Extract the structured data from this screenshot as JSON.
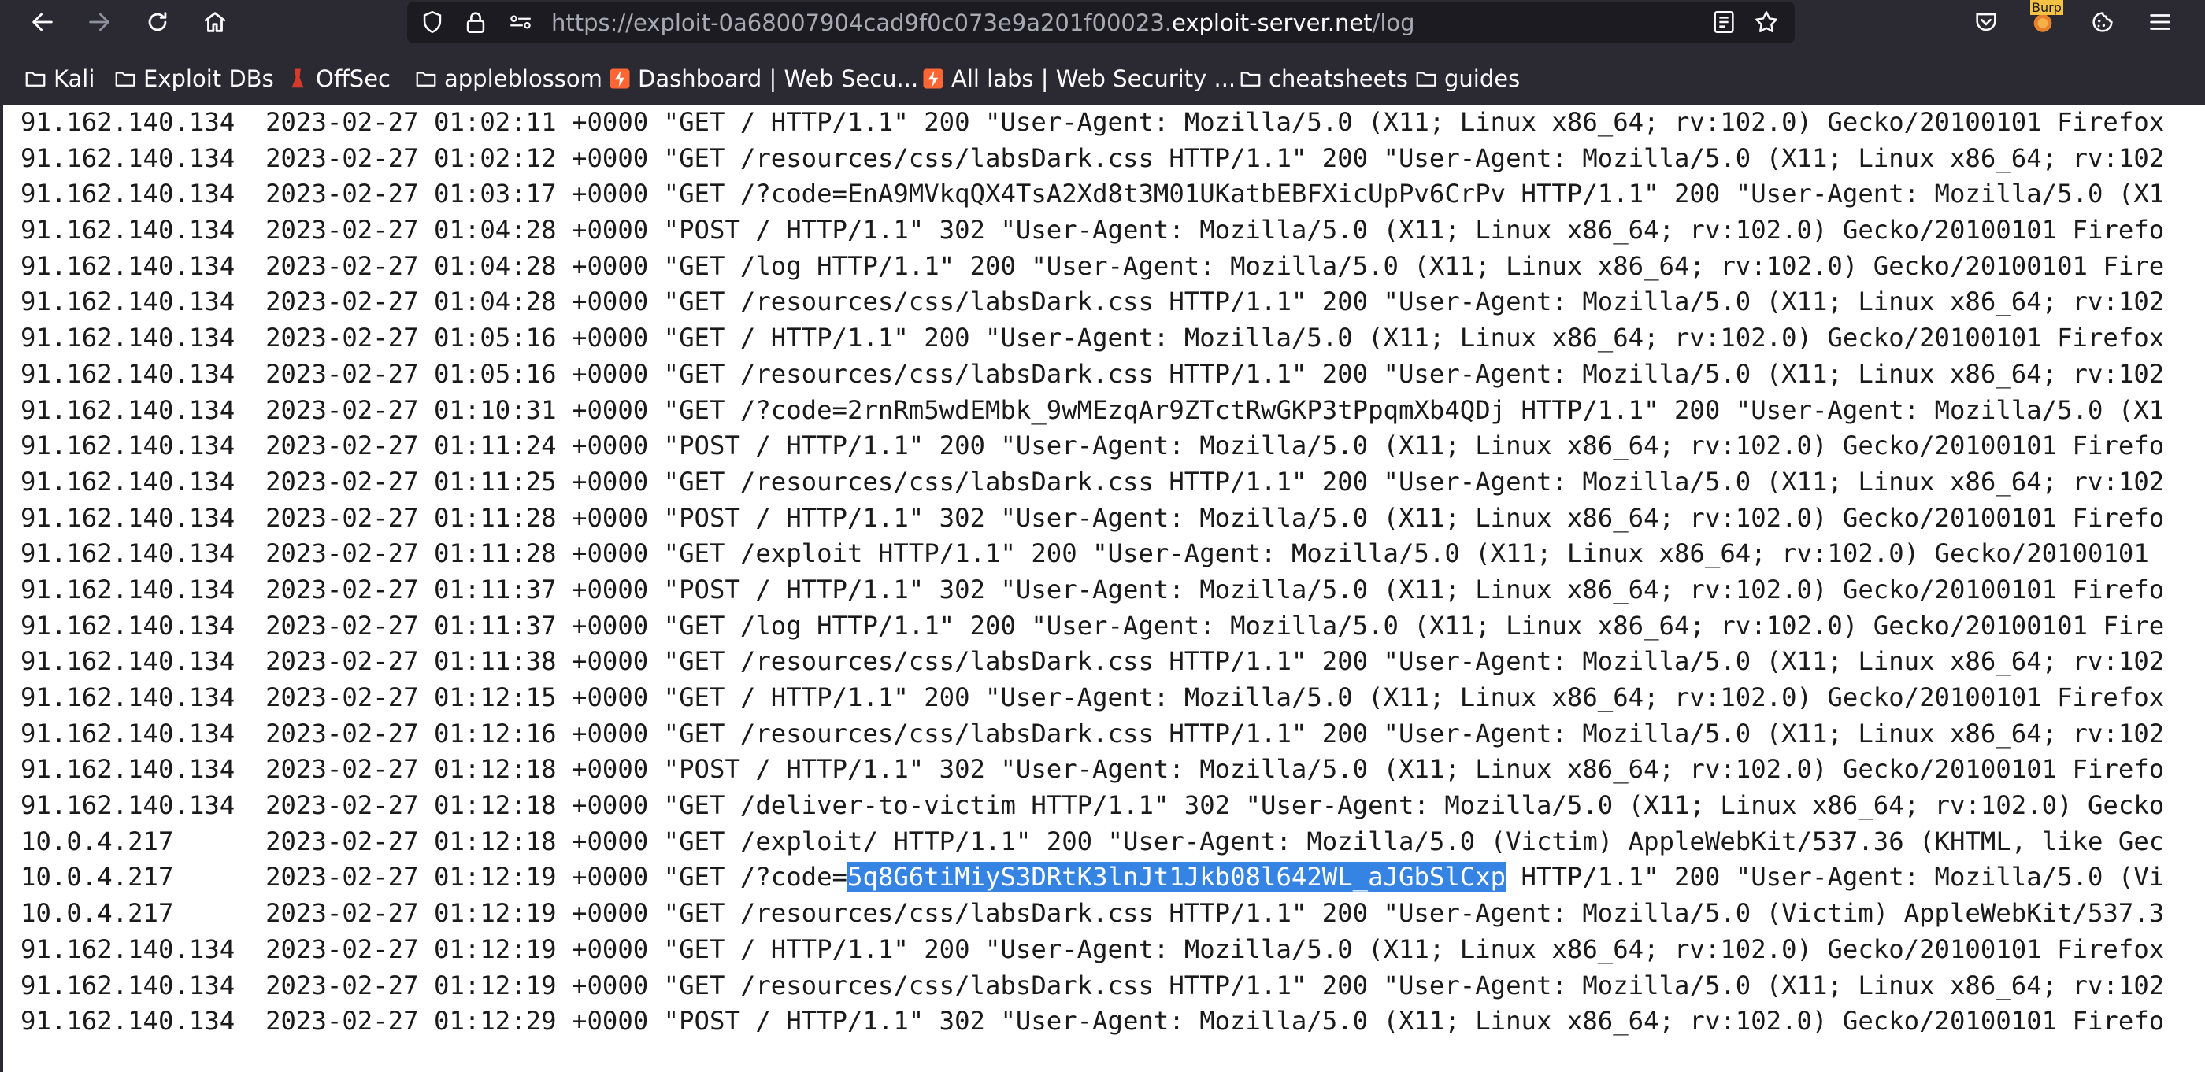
{
  "browser": {
    "url_prefix": "https://exploit-0a68007904cad9f0c073e9a201f00023.",
    "url_domain": "exploit-server.net",
    "url_suffix": "/log",
    "badge": "Burp"
  },
  "bookmarks": [
    {
      "label": "Kali",
      "icon": "folder-icon"
    },
    {
      "label": "Exploit DBs",
      "icon": "folder-icon"
    },
    {
      "label": "OffSec",
      "icon": "offsec-icon"
    },
    {
      "label": "appleblossom",
      "icon": "folder-icon"
    },
    {
      "label": "Dashboard | Web Secu...",
      "icon": "portswigger-icon"
    },
    {
      "label": "All labs | Web Security ...",
      "icon": "portswigger-icon"
    },
    {
      "label": "cheatsheets",
      "icon": "folder-icon"
    },
    {
      "label": "guides",
      "icon": "folder-icon"
    }
  ],
  "log": {
    "lines": [
      "91.162.140.134  2023-02-27 01:02:11 +0000 \"GET / HTTP/1.1\" 200 \"User-Agent: Mozilla/5.0 (X11; Linux x86_64; rv:102.0) Gecko/20100101 Firefox",
      "91.162.140.134  2023-02-27 01:02:12 +0000 \"GET /resources/css/labsDark.css HTTP/1.1\" 200 \"User-Agent: Mozilla/5.0 (X11; Linux x86_64; rv:102",
      "91.162.140.134  2023-02-27 01:03:17 +0000 \"GET /?code=EnA9MVkqQX4TsA2Xd8t3M01UKatbEBFXicUpPv6CrPv HTTP/1.1\" 200 \"User-Agent: Mozilla/5.0 (X1",
      "91.162.140.134  2023-02-27 01:04:28 +0000 \"POST / HTTP/1.1\" 302 \"User-Agent: Mozilla/5.0 (X11; Linux x86_64; rv:102.0) Gecko/20100101 Firefo",
      "91.162.140.134  2023-02-27 01:04:28 +0000 \"GET /log HTTP/1.1\" 200 \"User-Agent: Mozilla/5.0 (X11; Linux x86_64; rv:102.0) Gecko/20100101 Fire",
      "91.162.140.134  2023-02-27 01:04:28 +0000 \"GET /resources/css/labsDark.css HTTP/1.1\" 200 \"User-Agent: Mozilla/5.0 (X11; Linux x86_64; rv:102",
      "91.162.140.134  2023-02-27 01:05:16 +0000 \"GET / HTTP/1.1\" 200 \"User-Agent: Mozilla/5.0 (X11; Linux x86_64; rv:102.0) Gecko/20100101 Firefox",
      "91.162.140.134  2023-02-27 01:05:16 +0000 \"GET /resources/css/labsDark.css HTTP/1.1\" 200 \"User-Agent: Mozilla/5.0 (X11; Linux x86_64; rv:102",
      "91.162.140.134  2023-02-27 01:10:31 +0000 \"GET /?code=2rnRm5wdEMbk_9wMEzqAr9ZTctRwGKP3tPpqmXb4QDj HTTP/1.1\" 200 \"User-Agent: Mozilla/5.0 (X1",
      "91.162.140.134  2023-02-27 01:11:24 +0000 \"POST / HTTP/1.1\" 200 \"User-Agent: Mozilla/5.0 (X11; Linux x86_64; rv:102.0) Gecko/20100101 Firefo",
      "91.162.140.134  2023-02-27 01:11:25 +0000 \"GET /resources/css/labsDark.css HTTP/1.1\" 200 \"User-Agent: Mozilla/5.0 (X11; Linux x86_64; rv:102",
      "91.162.140.134  2023-02-27 01:11:28 +0000 \"POST / HTTP/1.1\" 302 \"User-Agent: Mozilla/5.0 (X11; Linux x86_64; rv:102.0) Gecko/20100101 Firefo",
      "91.162.140.134  2023-02-27 01:11:28 +0000 \"GET /exploit HTTP/1.1\" 200 \"User-Agent: Mozilla/5.0 (X11; Linux x86_64; rv:102.0) Gecko/20100101 ",
      "91.162.140.134  2023-02-27 01:11:37 +0000 \"POST / HTTP/1.1\" 302 \"User-Agent: Mozilla/5.0 (X11; Linux x86_64; rv:102.0) Gecko/20100101 Firefo",
      "91.162.140.134  2023-02-27 01:11:37 +0000 \"GET /log HTTP/1.1\" 200 \"User-Agent: Mozilla/5.0 (X11; Linux x86_64; rv:102.0) Gecko/20100101 Fire",
      "91.162.140.134  2023-02-27 01:11:38 +0000 \"GET /resources/css/labsDark.css HTTP/1.1\" 200 \"User-Agent: Mozilla/5.0 (X11; Linux x86_64; rv:102",
      "91.162.140.134  2023-02-27 01:12:15 +0000 \"GET / HTTP/1.1\" 200 \"User-Agent: Mozilla/5.0 (X11; Linux x86_64; rv:102.0) Gecko/20100101 Firefox",
      "91.162.140.134  2023-02-27 01:12:16 +0000 \"GET /resources/css/labsDark.css HTTP/1.1\" 200 \"User-Agent: Mozilla/5.0 (X11; Linux x86_64; rv:102",
      "91.162.140.134  2023-02-27 01:12:18 +0000 \"POST / HTTP/1.1\" 302 \"User-Agent: Mozilla/5.0 (X11; Linux x86_64; rv:102.0) Gecko/20100101 Firefo",
      "91.162.140.134  2023-02-27 01:12:18 +0000 \"GET /deliver-to-victim HTTP/1.1\" 302 \"User-Agent: Mozilla/5.0 (X11; Linux x86_64; rv:102.0) Gecko",
      "10.0.4.217      2023-02-27 01:12:18 +0000 \"GET /exploit/ HTTP/1.1\" 200 \"User-Agent: Mozilla/5.0 (Victim) AppleWebKit/537.36 (KHTML, like Gec",
      null,
      "10.0.4.217      2023-02-27 01:12:19 +0000 \"GET /resources/css/labsDark.css HTTP/1.1\" 200 \"User-Agent: Mozilla/5.0 (Victim) AppleWebKit/537.3",
      "91.162.140.134  2023-02-27 01:12:19 +0000 \"GET / HTTP/1.1\" 200 \"User-Agent: Mozilla/5.0 (X11; Linux x86_64; rv:102.0) Gecko/20100101 Firefox",
      "91.162.140.134  2023-02-27 01:12:19 +0000 \"GET /resources/css/labsDark.css HTTP/1.1\" 200 \"User-Agent: Mozilla/5.0 (X11; Linux x86_64; rv:102",
      "91.162.140.134  2023-02-27 01:12:29 +0000 \"POST / HTTP/1.1\" 302 \"User-Agent: Mozilla/5.0 (X11; Linux x86_64; rv:102.0) Gecko/20100101 Firefo"
    ],
    "highlighted_line": {
      "before": "10.0.4.217      2023-02-27 01:12:19 +0000 \"GET /?code=",
      "selected": "5q8G6tiMiyS3DRtK3lnJt1Jkb08l642WL_aJGbSlCxp",
      "after": " HTTP/1.1\" 200 \"User-Agent: Mozilla/5.0 (Vi"
    }
  },
  "colors": {
    "chrome_bg": "#2b2a33",
    "urlbar_bg": "#1c1b22",
    "selection": "#3584e4"
  }
}
